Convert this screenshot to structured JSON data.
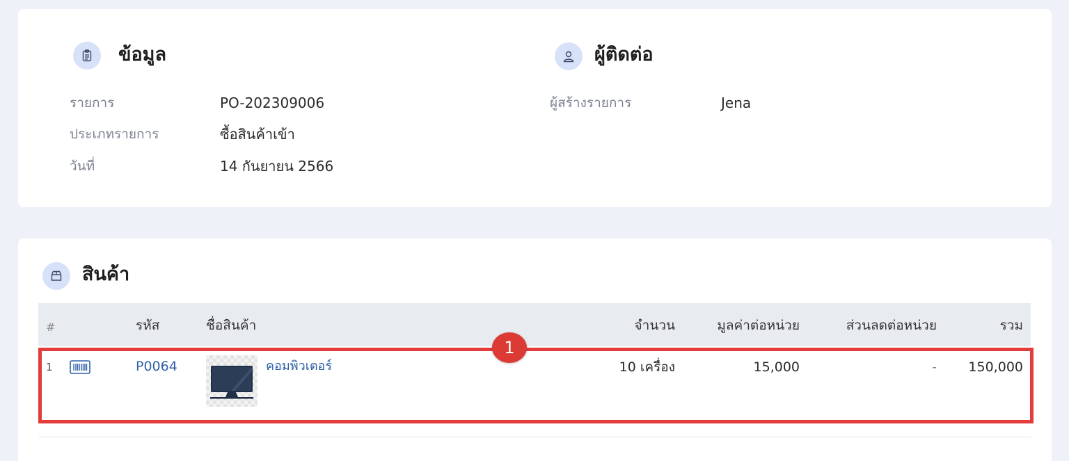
{
  "info": {
    "title": "ข้อมูล",
    "icon": "clipboard-icon",
    "rows": [
      {
        "label": "รายการ",
        "value": "PO-202309006"
      },
      {
        "label": "ประเภทรายการ",
        "value": "ซื้อสินค้าเข้า"
      },
      {
        "label": "วันที่",
        "value": "14 กันยายน 2566"
      }
    ]
  },
  "contact": {
    "title": "ผู้ติดต่อ",
    "icon": "user-icon",
    "rows": [
      {
        "label": "ผู้สร้างรายการ",
        "value": "Jena"
      }
    ]
  },
  "products": {
    "title": "สินค้า",
    "icon": "box-icon",
    "columns": {
      "index": "#",
      "code": "รหัส",
      "name": "ชื่อสินค้า",
      "qty": "จำนวน",
      "unit_price": "มูลค่าต่อหน่วย",
      "discount": "ส่วนลดต่อหน่วย",
      "total": "รวม"
    },
    "rows": [
      {
        "index": "1",
        "type_icon": "barcode-icon",
        "code": "P0064",
        "thumbnail_icon": "monitor-icon",
        "name": "คอมพิวเตอร์",
        "qty": "10 เครื่อง",
        "unit_price": "15,000",
        "discount": "-",
        "total": "150,000"
      }
    ]
  },
  "annotation": {
    "badge": "1"
  },
  "colors": {
    "background": "#eef1f8",
    "icon_circle": "#d7e1f7",
    "link": "#2f5fa7",
    "highlight": "#e23d3a"
  }
}
